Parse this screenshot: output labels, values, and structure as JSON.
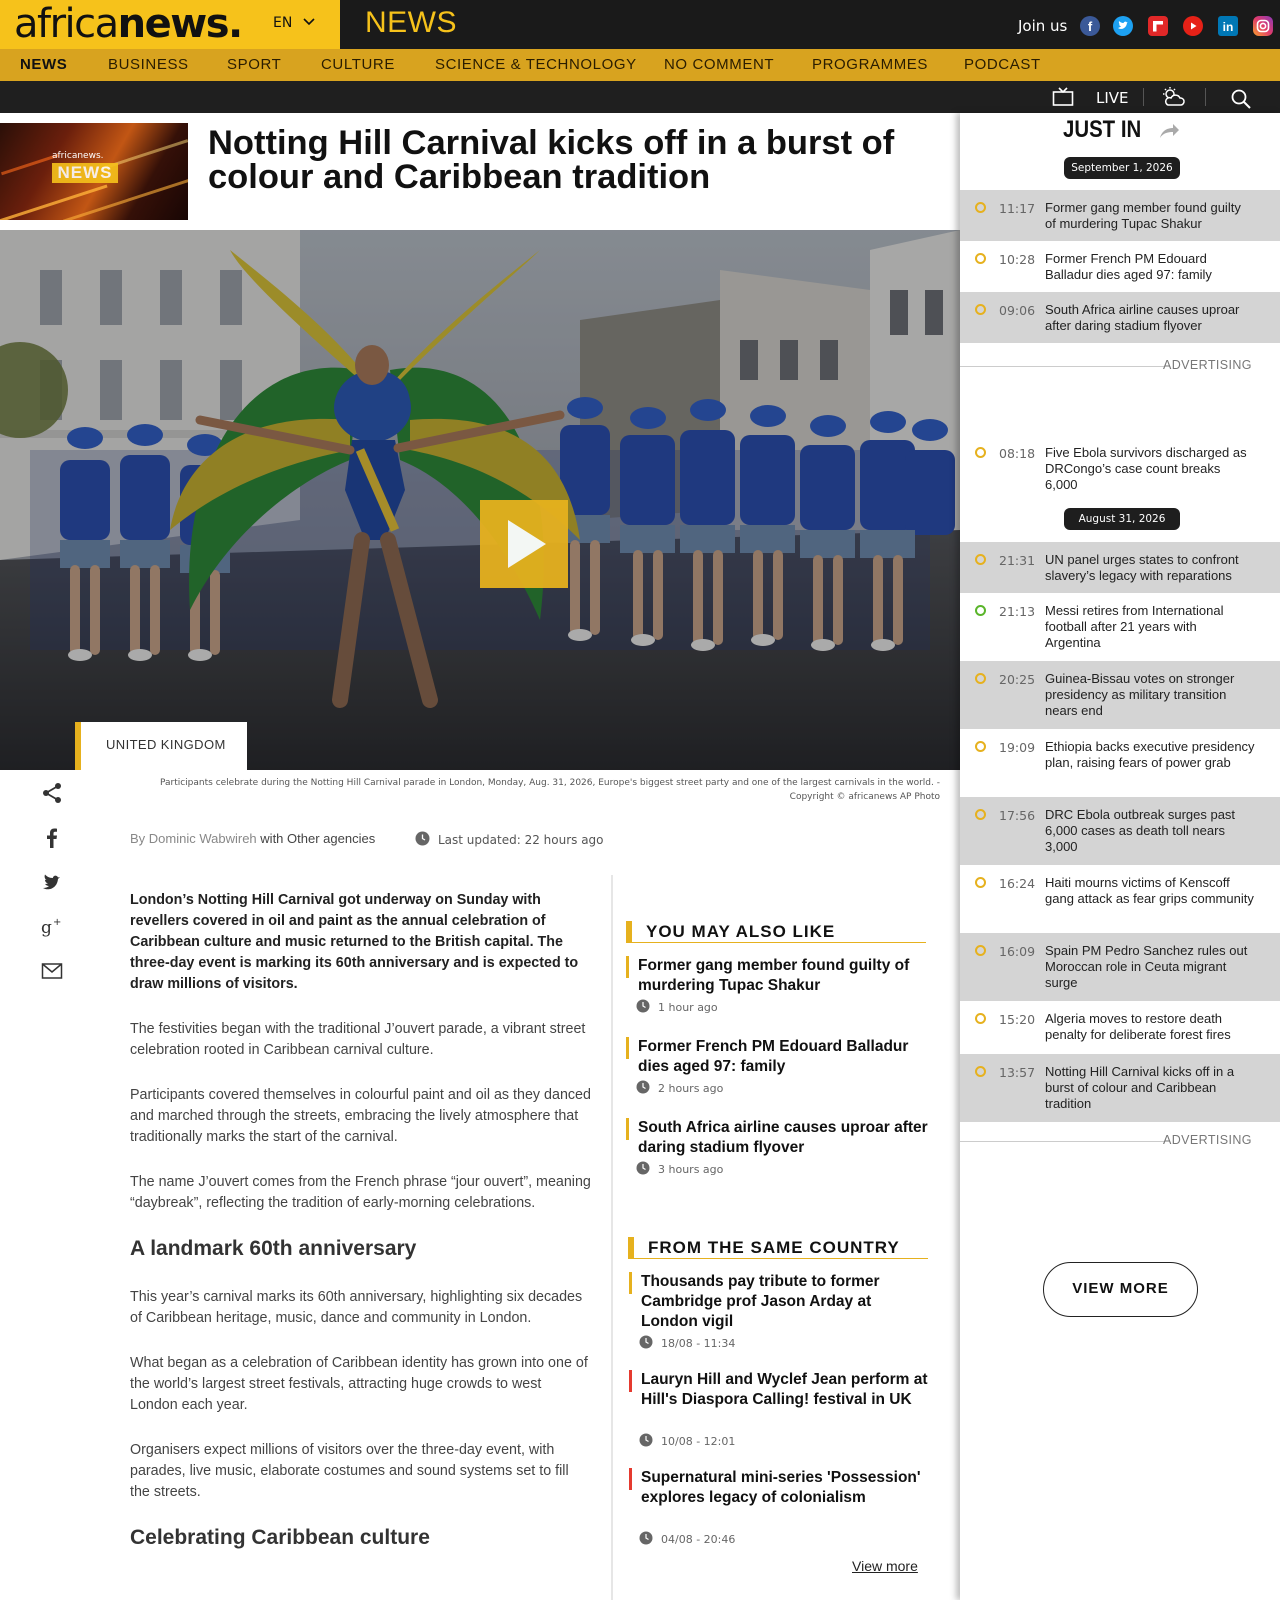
{
  "brand": {
    "logo_light": "africa",
    "logo_bold": "news.",
    "language": "EN",
    "section": "NEWS"
  },
  "header": {
    "join_us": "Join us",
    "social": [
      "facebook-icon",
      "twitter-icon",
      "flipboard-icon",
      "youtube-icon",
      "linkedin-icon",
      "instagram-icon"
    ]
  },
  "nav": {
    "items": [
      "NEWS",
      "BUSINESS",
      "SPORT",
      "CULTURE",
      "SCIENCE & TECHNOLOGY",
      "NO COMMENT",
      "PROGRAMMES",
      "PODCAST"
    ],
    "active": "NEWS"
  },
  "subbar": {
    "live": "LIVE"
  },
  "thumb": {
    "brand": "africanews.",
    "label": "NEWS"
  },
  "article": {
    "headline": "Notting Hill Carnival kicks off in a burst of colour and Caribbean tradition",
    "country": "UNITED KINGDOM",
    "caption": "Participants celebrate during the Notting Hill Carnival parade in London, Monday, Aug. 31, 2026, Europe's biggest street party and one of the largest carnivals in the world.  -",
    "copyright": "Copyright © africanews  AP Photo",
    "by": "By Dominic Wabwireh",
    "agencies": "with Other agencies",
    "updated": "Last updated: 22 hours ago",
    "p1": "London’s Notting Hill Carnival got underway on Sunday with revellers covered in oil and paint as the annual celebration of Caribbean culture and music returned to the British capital. The three-day event is marking its 60th anniversary and is expected to draw millions of visitors.",
    "p2": "The festivities began with the traditional J’ouvert parade, a vibrant street celebration rooted in Caribbean carnival culture.",
    "p3": "Participants covered themselves in colourful paint and oil as they danced and marched through the streets, embracing the lively atmosphere that traditionally marks the start of the carnival.",
    "p4": "The name J’ouvert comes from the French phrase “jour ouvert”, meaning “daybreak”, reflecting the tradition of early-morning celebrations.",
    "h2a": "A landmark 60th anniversary",
    "p5": "This year’s carnival marks its 60th anniversary, highlighting six decades of Caribbean heritage, music, dance and community in London.",
    "p6": "What began as a celebration of Caribbean identity has grown into one of the world’s largest street festivals, attracting huge crowds to west London each year.",
    "p7": "Organisers expect millions of visitors over the three-day event, with parades, live music, elaborate costumes and sound systems set to fill the streets.",
    "h2b": "Celebrating Caribbean culture"
  },
  "share": [
    "share-icon",
    "facebook-share-icon",
    "twitter-share-icon",
    "google-plus-share-icon",
    "email-share-icon"
  ],
  "you_may_also_like": {
    "title": "YOU MAY ALSO LIKE",
    "items": [
      {
        "title": "Former gang member found guilty of murdering Tupac Shakur",
        "time": "1 hour ago"
      },
      {
        "title": "Former French PM Edouard Balladur dies aged 97: family",
        "time": "2 hours ago"
      },
      {
        "title": "South Africa airline causes uproar after daring stadium flyover",
        "time": "3 hours ago"
      }
    ]
  },
  "same_country": {
    "title": "FROM THE SAME COUNTRY",
    "items": [
      {
        "title": "Thousands pay tribute to former Cambridge prof Jason Arday at London vigil",
        "time": "18/08 - 11:34",
        "color": "#e6b11e"
      },
      {
        "title": "Lauryn Hill and Wyclef Jean perform at Hill's Diaspora Calling! festival in UK",
        "time": "10/08 - 12:01",
        "color": "#e53a2f"
      },
      {
        "title": "Supernatural mini-series 'Possession' explores legacy of colonialism",
        "time": "04/08 - 20:46",
        "color": "#e53a2f"
      }
    ],
    "view_more": "View more"
  },
  "just_in": {
    "title": "JUST IN",
    "dates": [
      "September 1, 2026",
      "August 31, 2026"
    ],
    "items": [
      {
        "time": "11:17",
        "title": "Former gang member found guilty of murdering Tupac Shakur"
      },
      {
        "time": "10:28",
        "title": "Former French PM Edouard Balladur dies aged 97: family"
      },
      {
        "time": "09:06",
        "title": "South Africa airline causes uproar after daring stadium flyover"
      },
      {
        "time": "08:18",
        "title": "Five Ebola survivors discharged as DRCongo’s case count breaks 6,000"
      },
      {
        "time": "21:31",
        "title": "UN panel urges states to confront slavery’s legacy with reparations"
      },
      {
        "time": "21:13",
        "title": "Messi retires from International football after 21 years with Argentina"
      },
      {
        "time": "20:25",
        "title": "Guinea-Bissau votes on stronger presidency as military transition nears end"
      },
      {
        "time": "19:09",
        "title": "Ethiopia backs executive presidency plan, raising fears of power grab"
      },
      {
        "time": "17:56",
        "title": "DRC Ebola outbreak surges past 6,000 cases as death toll nears 3,000"
      },
      {
        "time": "16:24",
        "title": "Haiti mourns victims of Kenscoff gang attack as fear grips community"
      },
      {
        "time": "16:09",
        "title": "Spain PM Pedro Sanchez rules out Moroccan role in Ceuta migrant surge"
      },
      {
        "time": "15:20",
        "title": "Algeria moves to restore death penalty for deliberate forest fires"
      },
      {
        "time": "13:57",
        "title": "Notting Hill Carnival kicks off in a burst of colour and Caribbean tradition"
      }
    ],
    "advertising": "ADVERTISING",
    "view_more": "VIEW MORE"
  },
  "colors": {
    "brand_yellow": "#f6c21b",
    "nav_gold": "#d8a31f",
    "accent_red": "#e53a2f",
    "live_green": "#5ab52a"
  }
}
